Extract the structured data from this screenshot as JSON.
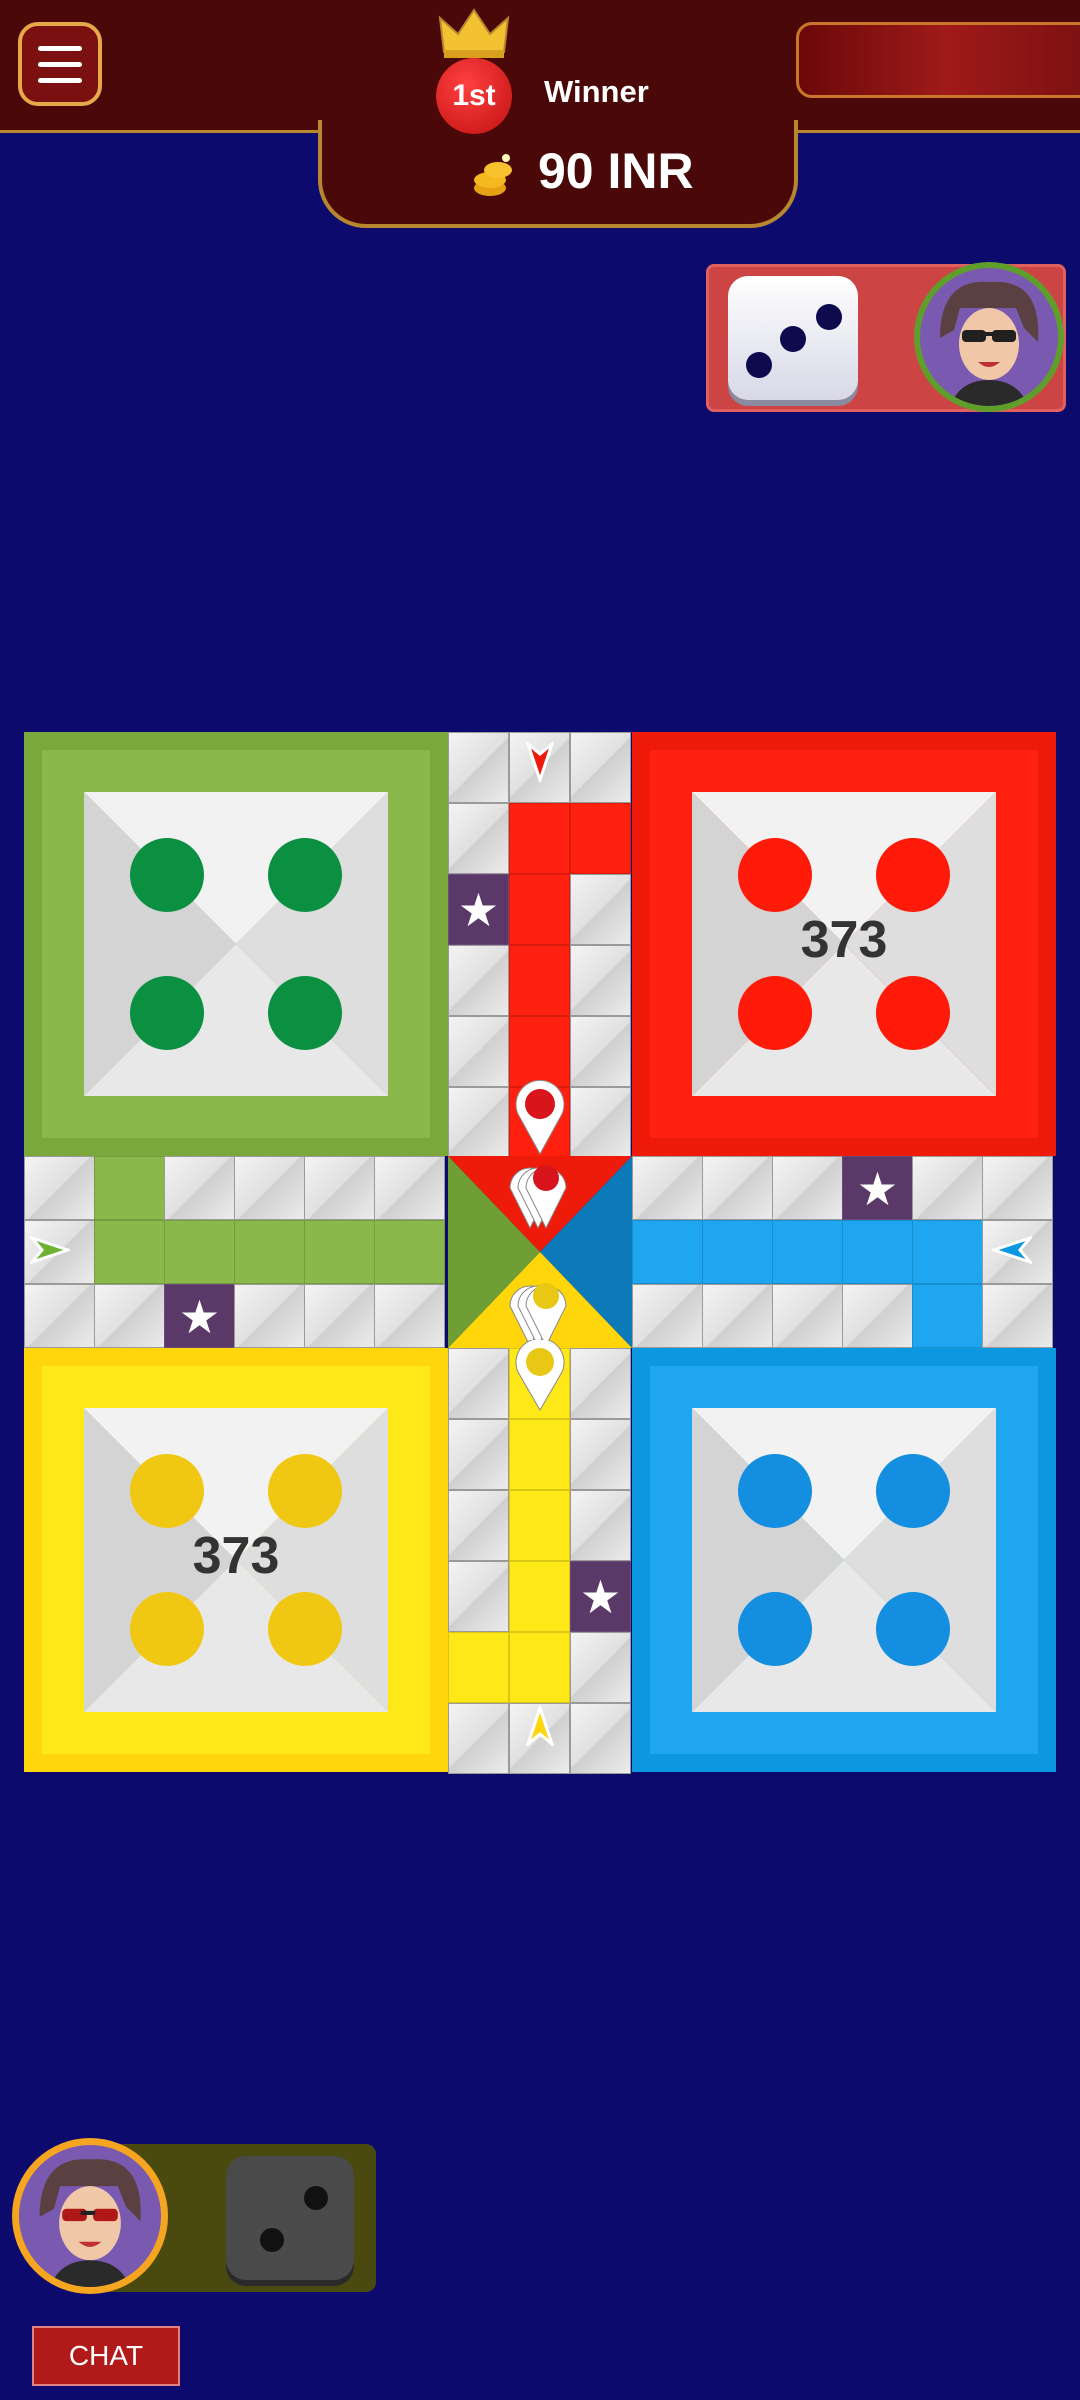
{
  "header": {
    "rank": "1st",
    "winner_label": "Winner",
    "prize": "90 INR"
  },
  "opponent": {
    "dice_value": 3,
    "avatar": "player-avatar-icon"
  },
  "board": {
    "red_yard_score": "373",
    "yellow_yard_score": "373",
    "colors": {
      "green": "#8bb84a",
      "red": "#ff2010",
      "yellow": "#ffe818",
      "blue": "#1ea7f0",
      "star": "#5a3868"
    }
  },
  "me": {
    "dice_value": 2,
    "avatar": "player-avatar-icon"
  },
  "chat": {
    "label": "CHAT"
  }
}
